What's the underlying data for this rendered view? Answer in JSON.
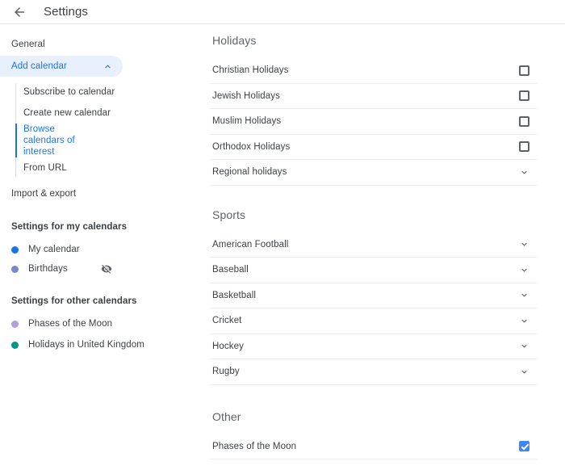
{
  "header": {
    "back_icon": "arrow-back-icon",
    "title": "Settings"
  },
  "sidebar": {
    "general_label": "General",
    "add_calendar": {
      "label": "Add calendar",
      "expanded_icon": "chevron-up-icon",
      "items": [
        {
          "label": "Subscribe to calendar",
          "selected": false
        },
        {
          "label": "Create new calendar",
          "selected": false
        },
        {
          "label": "Browse calendars of interest",
          "selected": true
        },
        {
          "label": "From URL",
          "selected": false
        }
      ]
    },
    "import_export_label": "Import & export",
    "my_calendars": {
      "label": "Settings for my calendars",
      "items": [
        {
          "label": "My calendar",
          "color": "#1a73e8",
          "hidden_icon": null
        },
        {
          "label": "Birthdays",
          "color": "#7986cb",
          "hidden_icon": "visibility-off-icon"
        }
      ]
    },
    "other_calendars": {
      "label": "Settings for other calendars",
      "items": [
        {
          "label": "Phases of the Moon",
          "color": "#b39ddb"
        },
        {
          "label": "Holidays in United Kingdom",
          "color": "#009688"
        }
      ]
    }
  },
  "main": {
    "sections": [
      {
        "title": "Holidays",
        "rows": [
          {
            "label": "Christian Holidays",
            "control": "checkbox",
            "checked": false
          },
          {
            "label": "Jewish Holidays",
            "control": "checkbox",
            "checked": false
          },
          {
            "label": "Muslim Holidays",
            "control": "checkbox",
            "checked": false
          },
          {
            "label": "Orthodox Holidays",
            "control": "checkbox",
            "checked": false
          },
          {
            "label": "Regional holidays",
            "control": "chevron",
            "checked": false
          }
        ]
      },
      {
        "title": "Sports",
        "rows": [
          {
            "label": "American Football",
            "control": "chevron",
            "checked": false
          },
          {
            "label": "Baseball",
            "control": "chevron",
            "checked": false
          },
          {
            "label": "Basketball",
            "control": "chevron",
            "checked": false
          },
          {
            "label": "Cricket",
            "control": "chevron",
            "checked": false
          },
          {
            "label": "Hockey",
            "control": "chevron",
            "checked": false
          },
          {
            "label": "Rugby",
            "control": "chevron",
            "checked": false
          }
        ]
      },
      {
        "title": "Other",
        "rows": [
          {
            "label": "Phases of the Moon",
            "control": "checkbox",
            "checked": true
          }
        ]
      }
    ]
  },
  "colors": {
    "accent": "#1a73e8",
    "accent_light_bg": "#e8f0fe",
    "checkbox_checked": "#4285f4",
    "text_primary": "#3c4043",
    "text_secondary": "#5f6368",
    "divider": "#ededed"
  }
}
